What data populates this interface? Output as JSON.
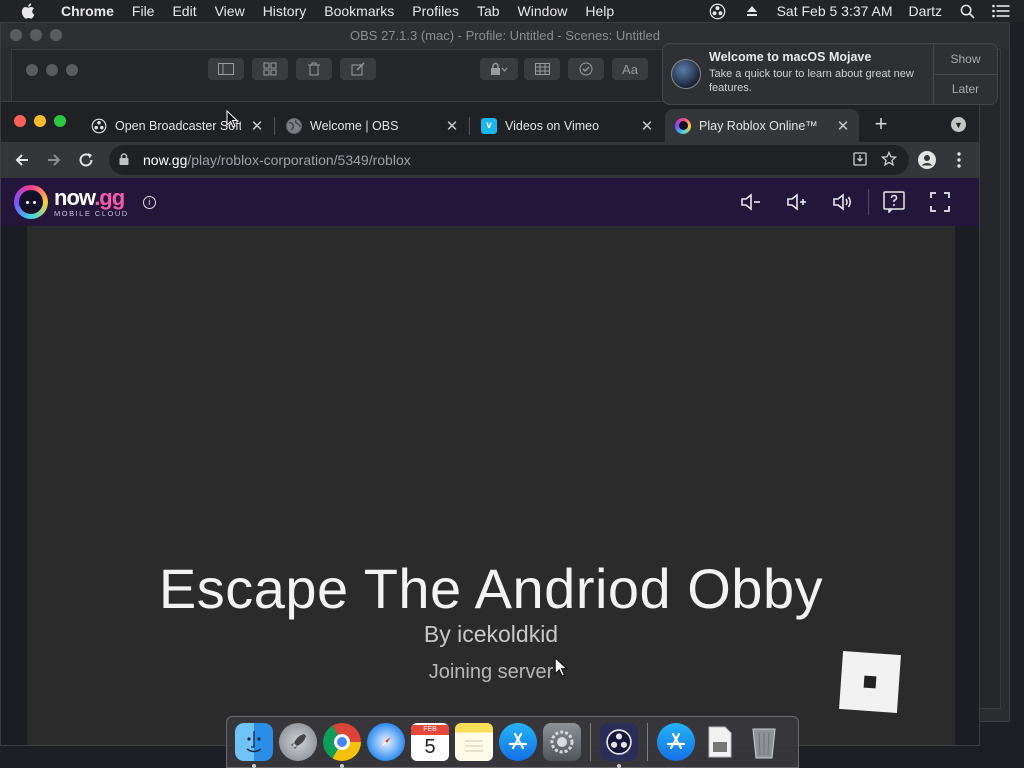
{
  "menubar": {
    "app_name": "Chrome",
    "items": [
      "File",
      "Edit",
      "View",
      "History",
      "Bookmarks",
      "Profiles",
      "Tab",
      "Window",
      "Help"
    ],
    "datetime": "Sat Feb 5  3:37 AM",
    "user": "Dartz"
  },
  "obs": {
    "title": "OBS 27.1.3 (mac) - Profile: Untitled - Scenes: Untitled",
    "toolbar_text_button": "Aa"
  },
  "notification": {
    "title": "Welcome to macOS Mojave",
    "body": "Take a quick tour to learn about great new features.",
    "show_label": "Show",
    "later_label": "Later"
  },
  "chrome": {
    "tabs": [
      {
        "label": "Open Broadcaster Software | OBS",
        "favicon": "obs-icon",
        "active": false
      },
      {
        "label": "Welcome | OBS",
        "favicon": "globe-icon",
        "active": false
      },
      {
        "label": "Videos on Vimeo",
        "favicon": "vimeo-icon",
        "active": false
      },
      {
        "label": "Play Roblox Online™",
        "favicon": "nowgg-icon",
        "active": true
      }
    ],
    "url_host": "now.gg",
    "url_path": "/play/roblox-corporation/5349/roblox"
  },
  "nowgg": {
    "brand_name": "now",
    "brand_suffix": ".gg",
    "brand_sub": "MOBILE CLOUD"
  },
  "game": {
    "title": "Escape The Andriod Obby",
    "author": "By icekoldkid",
    "status": "Joining server"
  },
  "dock": {
    "apps": [
      "finder",
      "launchpad",
      "chrome",
      "safari",
      "calendar",
      "notes",
      "app-store",
      "system-preferences",
      "obs",
      "app-store-downloads",
      "document",
      "trash"
    ],
    "calendar_month": "FEB",
    "calendar_day": "5"
  },
  "colors": {
    "nowgg_header": "#23163a",
    "game_bg": "#2b2b2b",
    "chrome_toolbar": "#35363a"
  }
}
